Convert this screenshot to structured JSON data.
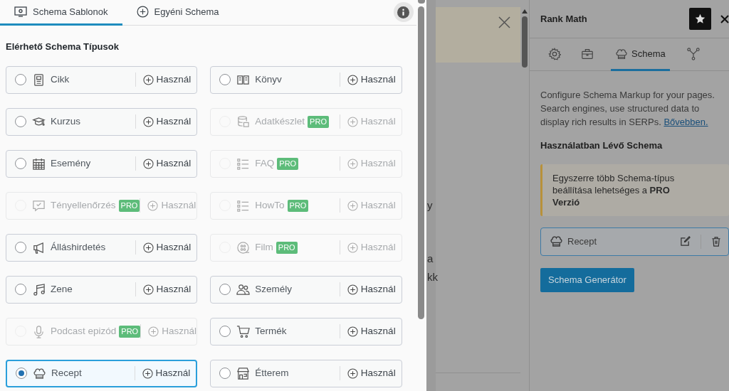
{
  "modal": {
    "tabs": [
      {
        "label": "Schema Sablonok",
        "selected": true
      },
      {
        "label": "Egyéni Schema",
        "selected": false
      }
    ],
    "heading": "Elérhető Schema Típusok",
    "types": [
      {
        "name": "Cikk",
        "pro": false,
        "selected": false,
        "action": "Használ"
      },
      {
        "name": "Könyv",
        "pro": false,
        "selected": false,
        "action": "Használ"
      },
      {
        "name": "Kurzus",
        "pro": false,
        "selected": false,
        "action": "Használ"
      },
      {
        "name": "Adatkészlet",
        "pro": true,
        "badge": "PRO",
        "selected": false,
        "action": "Használ"
      },
      {
        "name": "Esemény",
        "pro": false,
        "selected": false,
        "action": "Használ"
      },
      {
        "name": "FAQ",
        "pro": true,
        "badge": "PRO",
        "selected": false,
        "action": "Használ"
      },
      {
        "name": "Tényellenőrzés",
        "pro": true,
        "badge": "PRO",
        "selected": false,
        "action": "Használ"
      },
      {
        "name": "HowTo",
        "pro": true,
        "badge": "PRO",
        "selected": false,
        "action": "Használ"
      },
      {
        "name": "Álláshirdetés",
        "pro": false,
        "selected": false,
        "action": "Használ"
      },
      {
        "name": "Film",
        "pro": true,
        "badge": "PRO",
        "selected": false,
        "action": "Használ"
      },
      {
        "name": "Zene",
        "pro": false,
        "selected": false,
        "action": "Használ"
      },
      {
        "name": "Személy",
        "pro": false,
        "selected": false,
        "action": "Használ"
      },
      {
        "name": "Podcast epizód",
        "pro": true,
        "badge": "PRO",
        "selected": false,
        "action": "Használ"
      },
      {
        "name": "Termék",
        "pro": false,
        "selected": false,
        "action": "Használ"
      },
      {
        "name": "Recept",
        "pro": false,
        "selected": true,
        "action": "Használ"
      },
      {
        "name": "Étterem",
        "pro": false,
        "selected": false,
        "action": "Használ"
      }
    ]
  },
  "editor_fragments": [
    "y",
    "a",
    "kk"
  ],
  "sidebar": {
    "title": "Rank Math",
    "tabs": [
      {
        "selected": false
      },
      {
        "selected": false
      },
      {
        "label": "Schema",
        "selected": true
      },
      {
        "selected": false
      }
    ],
    "description": "Configure Schema Markup for your pages. Search engines, use structured data to display rich results in SERPs.",
    "link": "Bővebben.",
    "in_use_heading": "Használatban Lévő Schema",
    "notice": "Egyszerre több Schema-típus beállítása lehetséges a **PRO Verzió**",
    "in_use": [
      {
        "name": "Recept"
      }
    ],
    "button": "Schema Generátor"
  }
}
